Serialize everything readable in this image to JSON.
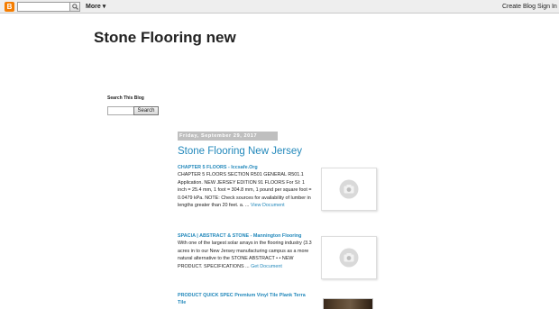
{
  "navbar": {
    "logo_letter": "B",
    "more_label": "More",
    "create_blog_label": "Create Blog",
    "sign_in_label": "Sign In"
  },
  "blog": {
    "title": "Stone Flooring new"
  },
  "sidebar": {
    "heading": "Search This Blog",
    "search_button_label": "Search"
  },
  "post": {
    "date": "Friday, September 29, 2017",
    "title": "Stone Flooring New Jersey",
    "entries": [
      {
        "title": "CHAPTER 5 FLOORS - Iccsafe.Org",
        "snippet": "CHAPTER 5 FLOORS SECTION R501 GENERAL R501.1 Application. NEW JERSEY EDITION 91 FLOORS For SI: 1 inch = 25.4 mm, 1 foot = 304.8 mm, 1 pound per square foot = 0.0479 kPa. NOTE: Check sources for availability of lumber in lengths greater than 20 feet. a. ...",
        "link": "View Document"
      },
      {
        "title": "SPACIA | ABSTRACT & STONE - Mannington Flooring",
        "snippet": "With one of the largest solar arrays in the flooring industry (3.3 acres in to our New Jersey manufacturing campus as a more natural alternative to the STONE ABSTRACT • • NEW PRODUCT. SPECIFICATIONS ...",
        "link": "Get Document"
      },
      {
        "title": "PRODUCT QUICK SPEC Premium Vinyl Tile Plank Terra Tile",
        "snippet": "",
        "link": ""
      }
    ]
  },
  "icons": {
    "logo": "blogger-logo-icon",
    "nav_search": "search-icon",
    "thumb_placeholder": "camera-icon"
  },
  "colors": {
    "brand": "#f57d00",
    "link": "#2288bb",
    "date_header_bg": "#bfbfbf",
    "navbar_bg": "#eeeeee"
  }
}
